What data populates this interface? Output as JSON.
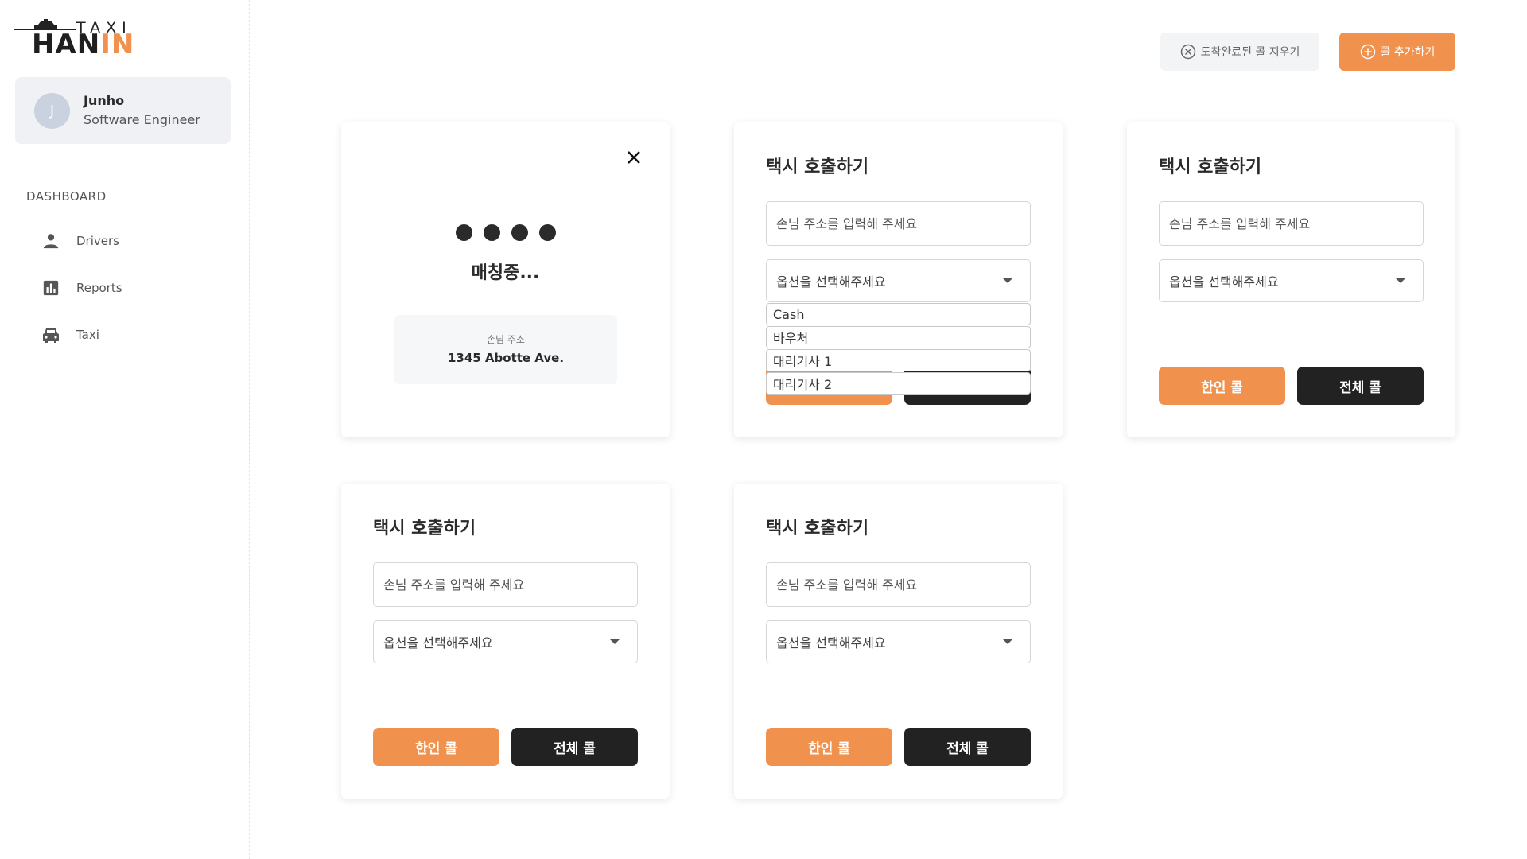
{
  "logo": {
    "top": "TAXI",
    "main": "HAN",
    "main_accent": "IN"
  },
  "profile": {
    "initial": "J",
    "name": "Junho",
    "role": "Software Engineer"
  },
  "sidebar": {
    "section": "DASHBOARD",
    "items": [
      {
        "label": "Drivers",
        "icon": "person-icon"
      },
      {
        "label": "Reports",
        "icon": "bar-chart-icon"
      },
      {
        "label": "Taxi",
        "icon": "taxi-icon"
      }
    ]
  },
  "toolbar": {
    "clear_label": "도착완료된 콜 지우기",
    "add_label": "콜 추가하기"
  },
  "colors": {
    "accent": "#f0924e",
    "dark": "#222222"
  },
  "matching_card": {
    "status": "매칭중...",
    "address_label": "손님 주소",
    "address_value": "1345 Abotte Ave."
  },
  "call_card": {
    "title": "택시 호출하기",
    "address_placeholder": "손님 주소를 입력해 주세요",
    "option_placeholder": "옵션을 선택해주세요",
    "discount_label": "한인 콜",
    "all_label": "전체 콜"
  },
  "dropdown_options": [
    "Cash",
    "바우처",
    "대리기사 1",
    "대리기사 2"
  ]
}
